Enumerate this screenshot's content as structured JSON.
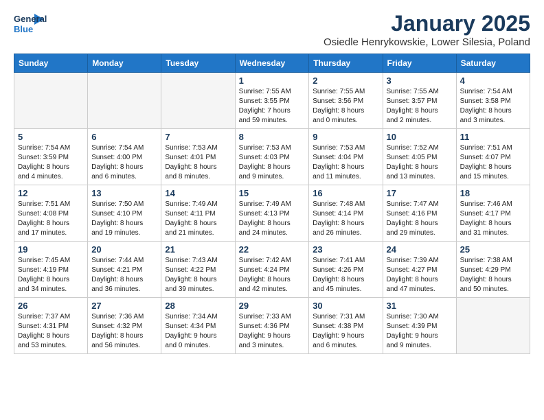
{
  "logo": {
    "line1": "General",
    "line2": "Blue"
  },
  "title": "January 2025",
  "location": "Osiedle Henrykowskie, Lower Silesia, Poland",
  "days_of_week": [
    "Sunday",
    "Monday",
    "Tuesday",
    "Wednesday",
    "Thursday",
    "Friday",
    "Saturday"
  ],
  "weeks": [
    [
      {
        "day": "",
        "info": ""
      },
      {
        "day": "",
        "info": ""
      },
      {
        "day": "",
        "info": ""
      },
      {
        "day": "1",
        "info": "Sunrise: 7:55 AM\nSunset: 3:55 PM\nDaylight: 7 hours\nand 59 minutes."
      },
      {
        "day": "2",
        "info": "Sunrise: 7:55 AM\nSunset: 3:56 PM\nDaylight: 8 hours\nand 0 minutes."
      },
      {
        "day": "3",
        "info": "Sunrise: 7:55 AM\nSunset: 3:57 PM\nDaylight: 8 hours\nand 2 minutes."
      },
      {
        "day": "4",
        "info": "Sunrise: 7:54 AM\nSunset: 3:58 PM\nDaylight: 8 hours\nand 3 minutes."
      }
    ],
    [
      {
        "day": "5",
        "info": "Sunrise: 7:54 AM\nSunset: 3:59 PM\nDaylight: 8 hours\nand 4 minutes."
      },
      {
        "day": "6",
        "info": "Sunrise: 7:54 AM\nSunset: 4:00 PM\nDaylight: 8 hours\nand 6 minutes."
      },
      {
        "day": "7",
        "info": "Sunrise: 7:53 AM\nSunset: 4:01 PM\nDaylight: 8 hours\nand 8 minutes."
      },
      {
        "day": "8",
        "info": "Sunrise: 7:53 AM\nSunset: 4:03 PM\nDaylight: 8 hours\nand 9 minutes."
      },
      {
        "day": "9",
        "info": "Sunrise: 7:53 AM\nSunset: 4:04 PM\nDaylight: 8 hours\nand 11 minutes."
      },
      {
        "day": "10",
        "info": "Sunrise: 7:52 AM\nSunset: 4:05 PM\nDaylight: 8 hours\nand 13 minutes."
      },
      {
        "day": "11",
        "info": "Sunrise: 7:51 AM\nSunset: 4:07 PM\nDaylight: 8 hours\nand 15 minutes."
      }
    ],
    [
      {
        "day": "12",
        "info": "Sunrise: 7:51 AM\nSunset: 4:08 PM\nDaylight: 8 hours\nand 17 minutes."
      },
      {
        "day": "13",
        "info": "Sunrise: 7:50 AM\nSunset: 4:10 PM\nDaylight: 8 hours\nand 19 minutes."
      },
      {
        "day": "14",
        "info": "Sunrise: 7:49 AM\nSunset: 4:11 PM\nDaylight: 8 hours\nand 21 minutes."
      },
      {
        "day": "15",
        "info": "Sunrise: 7:49 AM\nSunset: 4:13 PM\nDaylight: 8 hours\nand 24 minutes."
      },
      {
        "day": "16",
        "info": "Sunrise: 7:48 AM\nSunset: 4:14 PM\nDaylight: 8 hours\nand 26 minutes."
      },
      {
        "day": "17",
        "info": "Sunrise: 7:47 AM\nSunset: 4:16 PM\nDaylight: 8 hours\nand 29 minutes."
      },
      {
        "day": "18",
        "info": "Sunrise: 7:46 AM\nSunset: 4:17 PM\nDaylight: 8 hours\nand 31 minutes."
      }
    ],
    [
      {
        "day": "19",
        "info": "Sunrise: 7:45 AM\nSunset: 4:19 PM\nDaylight: 8 hours\nand 34 minutes."
      },
      {
        "day": "20",
        "info": "Sunrise: 7:44 AM\nSunset: 4:21 PM\nDaylight: 8 hours\nand 36 minutes."
      },
      {
        "day": "21",
        "info": "Sunrise: 7:43 AM\nSunset: 4:22 PM\nDaylight: 8 hours\nand 39 minutes."
      },
      {
        "day": "22",
        "info": "Sunrise: 7:42 AM\nSunset: 4:24 PM\nDaylight: 8 hours\nand 42 minutes."
      },
      {
        "day": "23",
        "info": "Sunrise: 7:41 AM\nSunset: 4:26 PM\nDaylight: 8 hours\nand 45 minutes."
      },
      {
        "day": "24",
        "info": "Sunrise: 7:39 AM\nSunset: 4:27 PM\nDaylight: 8 hours\nand 47 minutes."
      },
      {
        "day": "25",
        "info": "Sunrise: 7:38 AM\nSunset: 4:29 PM\nDaylight: 8 hours\nand 50 minutes."
      }
    ],
    [
      {
        "day": "26",
        "info": "Sunrise: 7:37 AM\nSunset: 4:31 PM\nDaylight: 8 hours\nand 53 minutes."
      },
      {
        "day": "27",
        "info": "Sunrise: 7:36 AM\nSunset: 4:32 PM\nDaylight: 8 hours\nand 56 minutes."
      },
      {
        "day": "28",
        "info": "Sunrise: 7:34 AM\nSunset: 4:34 PM\nDaylight: 9 hours\nand 0 minutes."
      },
      {
        "day": "29",
        "info": "Sunrise: 7:33 AM\nSunset: 4:36 PM\nDaylight: 9 hours\nand 3 minutes."
      },
      {
        "day": "30",
        "info": "Sunrise: 7:31 AM\nSunset: 4:38 PM\nDaylight: 9 hours\nand 6 minutes."
      },
      {
        "day": "31",
        "info": "Sunrise: 7:30 AM\nSunset: 4:39 PM\nDaylight: 9 hours\nand 9 minutes."
      },
      {
        "day": "",
        "info": ""
      }
    ]
  ]
}
